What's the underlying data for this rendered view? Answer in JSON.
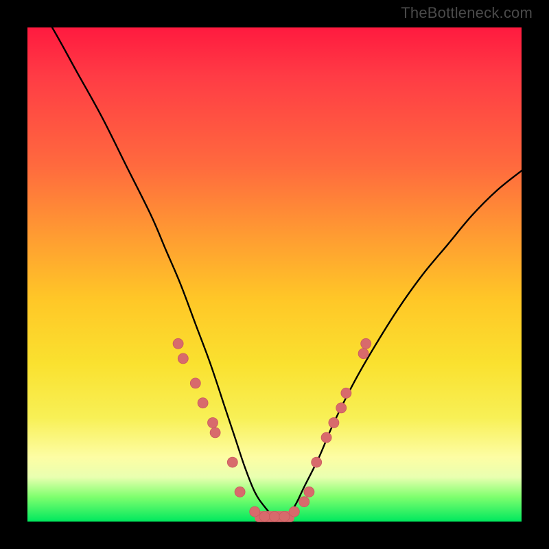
{
  "watermark": "TheBottleneck.com",
  "colors": {
    "frame": "#000000",
    "curve": "#000000",
    "marker_fill": "#d86a6c",
    "marker_stroke": "#c95a5e",
    "gradient_top": "#ff1a3f",
    "gradient_bottom": "#00e85e"
  },
  "chart_data": {
    "type": "line",
    "title": "",
    "xlabel": "",
    "ylabel": "",
    "xlim": [
      0,
      100
    ],
    "ylim": [
      0,
      100
    ],
    "grid": false,
    "legend": false,
    "series": [
      {
        "name": "bottleneck-curve",
        "x": [
          0,
          5,
          10,
          15,
          20,
          25,
          28,
          31,
          34,
          37,
          40,
          42,
          44,
          46,
          48,
          50,
          52,
          54,
          56,
          59,
          62,
          66,
          70,
          75,
          80,
          85,
          90,
          95,
          100
        ],
        "values": [
          108,
          100,
          91,
          82,
          72,
          62,
          55,
          48,
          40,
          32,
          23,
          17,
          11,
          6,
          3,
          1,
          1,
          3,
          7,
          13,
          20,
          28,
          35,
          43,
          50,
          56,
          62,
          67,
          71
        ]
      }
    ],
    "markers": [
      {
        "x": 30.5,
        "y": 36
      },
      {
        "x": 31.5,
        "y": 33
      },
      {
        "x": 34.0,
        "y": 28
      },
      {
        "x": 35.5,
        "y": 24
      },
      {
        "x": 37.5,
        "y": 20
      },
      {
        "x": 38.0,
        "y": 18
      },
      {
        "x": 41.5,
        "y": 12
      },
      {
        "x": 43.0,
        "y": 6
      },
      {
        "x": 46.0,
        "y": 2
      },
      {
        "x": 48.0,
        "y": 1
      },
      {
        "x": 50.0,
        "y": 1
      },
      {
        "x": 52.0,
        "y": 1
      },
      {
        "x": 54.0,
        "y": 2
      },
      {
        "x": 56.0,
        "y": 4
      },
      {
        "x": 57.0,
        "y": 6
      },
      {
        "x": 58.5,
        "y": 12
      },
      {
        "x": 60.5,
        "y": 17
      },
      {
        "x": 62.0,
        "y": 20
      },
      {
        "x": 63.5,
        "y": 23
      },
      {
        "x": 64.5,
        "y": 26
      },
      {
        "x": 68.0,
        "y": 34
      },
      {
        "x": 68.5,
        "y": 36
      }
    ],
    "plateau": {
      "x_start": 46,
      "x_end": 54,
      "y": 1,
      "thickness": 2.2
    }
  }
}
